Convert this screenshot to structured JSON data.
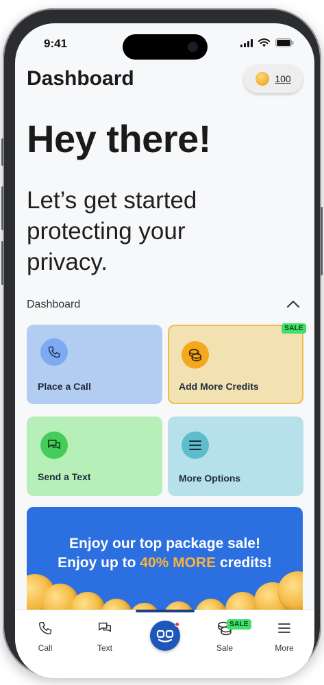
{
  "status_bar": {
    "time": "9:41"
  },
  "header": {
    "title": "Dashboard",
    "credits": "100"
  },
  "hero": {
    "title": "Hey there!",
    "subtitle": "Let’s get started protecting your privacy."
  },
  "section": {
    "label": "Dashboard"
  },
  "cards": {
    "call": {
      "label": "Place a Call",
      "color": "#b3cdf2"
    },
    "credits": {
      "label": "Add More Credits",
      "badge": "SALE",
      "color": "#f3e2b1"
    },
    "text": {
      "label": "Send a Text",
      "color": "#b6efb8"
    },
    "options": {
      "label": "More Options",
      "color": "#b7e1ea"
    }
  },
  "banner": {
    "line1": "Enjoy our top package sale!",
    "line2_prefix": "Enjoy up to ",
    "line2_highlight": "40% MORE",
    "line2_suffix": " credits!",
    "color": "#2b6fe0",
    "highlight_color": "#f9b43c"
  },
  "tabbar": {
    "items": [
      {
        "label": "Call",
        "icon": "phone-icon"
      },
      {
        "label": "Text",
        "icon": "chat-icon"
      },
      {
        "label": "",
        "icon": "app-logo-icon"
      },
      {
        "label": "Sale",
        "icon": "coins-icon",
        "badge": "SALE"
      },
      {
        "label": "More",
        "icon": "menu-icon"
      }
    ]
  }
}
